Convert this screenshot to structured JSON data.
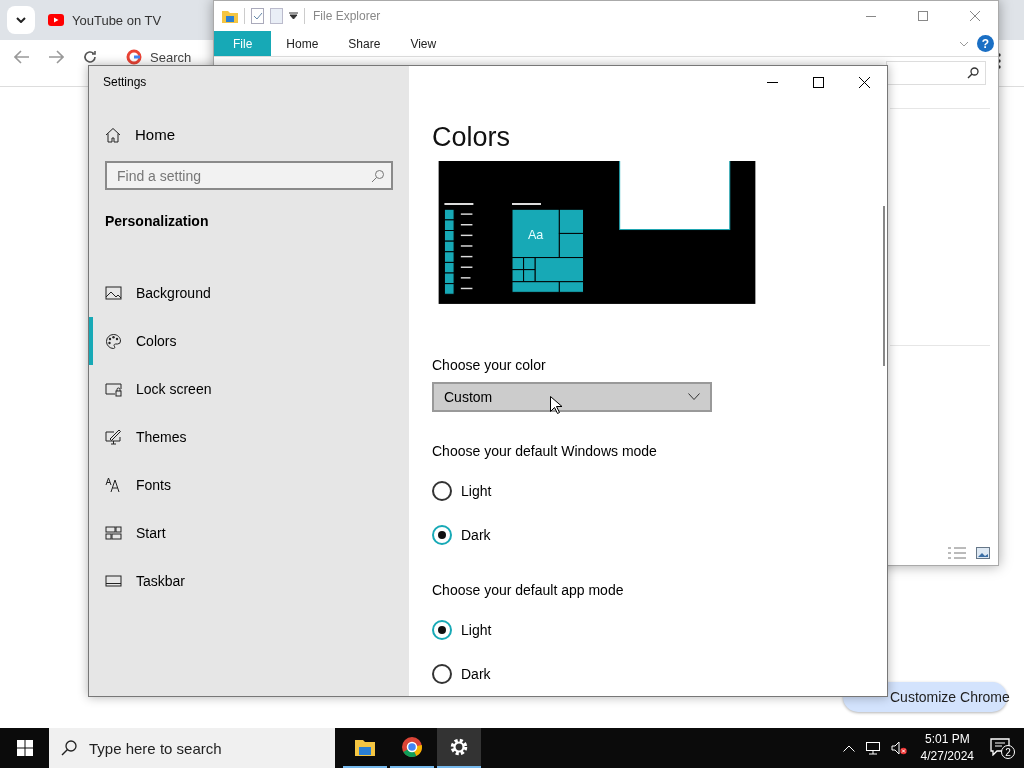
{
  "browser": {
    "tab_title": "YouTube on TV",
    "omnibox_text": "Search",
    "customize_button": "Customize Chrome"
  },
  "file_explorer": {
    "title": "File Explorer",
    "help": "?",
    "ribbon_tabs": [
      {
        "label": "File",
        "selected": true
      },
      {
        "label": "Home",
        "selected": false
      },
      {
        "label": "Share",
        "selected": false
      },
      {
        "label": "View",
        "selected": false
      }
    ]
  },
  "settings": {
    "title": "Settings",
    "home": "Home",
    "search": {
      "placeholder": "Find a setting"
    },
    "section": "Personalization",
    "nav": [
      {
        "label": "Background",
        "kind": "background",
        "selected": false
      },
      {
        "label": "Colors",
        "kind": "colors",
        "selected": true
      },
      {
        "label": "Lock screen",
        "kind": "lock",
        "selected": false
      },
      {
        "label": "Themes",
        "kind": "themes",
        "selected": false
      },
      {
        "label": "Fonts",
        "kind": "fonts",
        "selected": false
      },
      {
        "label": "Start",
        "kind": "start",
        "selected": false
      },
      {
        "label": "Taskbar",
        "kind": "taskbar",
        "selected": false
      }
    ],
    "page_title": "Colors",
    "preview": {
      "tile_text": "Aa"
    },
    "color_choice": {
      "label": "Choose your color",
      "value": "Custom"
    },
    "windows_mode": {
      "label": "Choose your default Windows mode",
      "options": [
        {
          "label": "Light",
          "selected": false
        },
        {
          "label": "Dark",
          "selected": true
        }
      ]
    },
    "app_mode": {
      "label": "Choose your default app mode",
      "options": [
        {
          "label": "Light",
          "selected": true
        },
        {
          "label": "Dark",
          "selected": false
        }
      ]
    }
  },
  "taskbar": {
    "search_placeholder": "Type here to search",
    "apps": [
      {
        "kind": "explorer",
        "selected": false
      },
      {
        "kind": "chrome",
        "selected": false
      },
      {
        "kind": "settings",
        "selected": true
      }
    ],
    "time": "5:01 PM",
    "date": "4/27/2024",
    "notification_count": "2"
  }
}
